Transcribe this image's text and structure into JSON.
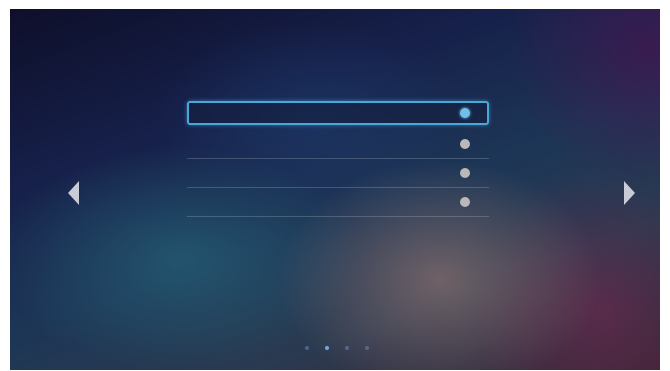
{
  "screen": {
    "title": "",
    "options": [
      {
        "label": "",
        "selected": true
      },
      {
        "label": "",
        "selected": false
      },
      {
        "label": "",
        "selected": false
      },
      {
        "label": "",
        "selected": false
      }
    ]
  },
  "pagination": {
    "total": 4,
    "current": 2
  },
  "colors": {
    "selection_border": "#4aa8d8",
    "selected_radio": "#6fc0e8",
    "radio": "#b9b9b9",
    "arrow": "#c9ccd6"
  },
  "icons": {
    "prev": "chevron-left-icon",
    "next": "chevron-right-icon"
  }
}
